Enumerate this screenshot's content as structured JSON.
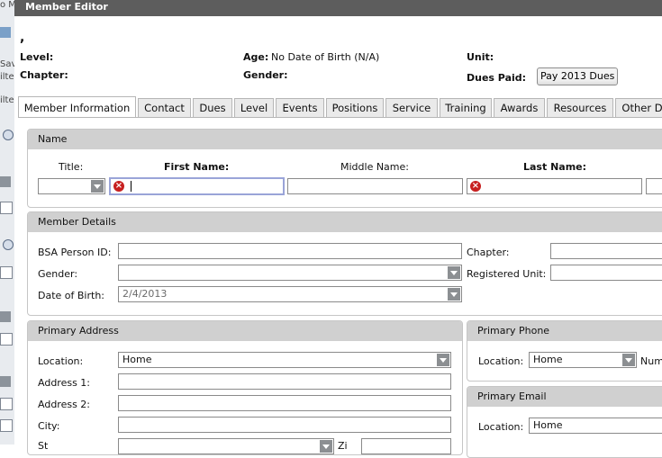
{
  "window": {
    "title": "Member Editor"
  },
  "background_fragments": [
    "o M",
    "Sav",
    "ilte",
    "ilte"
  ],
  "member": {
    "display_name": ",",
    "level_label": "Level:",
    "age_label": "Age:",
    "age_value": "No Date of Birth (N/A)",
    "unit_label": "Unit:",
    "chapter_label": "Chapter:",
    "gender_label": "Gender:",
    "dues_paid_label": "Dues Paid:",
    "pay_dues_button": "Pay 2013 Dues"
  },
  "tabs": [
    {
      "label": "Member Information",
      "active": true
    },
    {
      "label": "Contact"
    },
    {
      "label": "Dues"
    },
    {
      "label": "Level"
    },
    {
      "label": "Events"
    },
    {
      "label": "Positions"
    },
    {
      "label": "Service"
    },
    {
      "label": "Training"
    },
    {
      "label": "Awards"
    },
    {
      "label": "Resources"
    },
    {
      "label": "Other D"
    }
  ],
  "name_section": {
    "header": "Name",
    "title_label": "Title:",
    "first_name_label": "First Name:",
    "middle_name_label": "Middle Name:",
    "last_name_label": "Last Name:",
    "title_value": "",
    "first_name_value": "",
    "middle_name_value": "",
    "last_name_value": ""
  },
  "member_details": {
    "header": "Member Details",
    "bsa_person_id_label": "BSA Person ID:",
    "gender_label": "Gender:",
    "dob_label": "Date of Birth:",
    "dob_value": "2/4/2013",
    "chapter_label": "Chapter:",
    "registered_unit_label": "Registered Unit:"
  },
  "primary_address": {
    "header": "Primary Address",
    "location_label": "Location:",
    "location_value": "Home",
    "address1_label": "Address 1:",
    "address2_label": "Address 2:",
    "city_label": "City:",
    "state_label": "St",
    "zip_label": "Zi"
  },
  "primary_phone": {
    "header": "Primary Phone",
    "location_label": "Location:",
    "location_value": "Home",
    "number_label": "Num"
  },
  "primary_email": {
    "header": "Primary Email",
    "location_label": "Location:",
    "location_value": "Home"
  },
  "colors": {
    "titlebar": "#5d5d5d",
    "section_header": "#d0d0d0",
    "error": "#c71f1f",
    "focus_border": "#9aa4d8"
  }
}
